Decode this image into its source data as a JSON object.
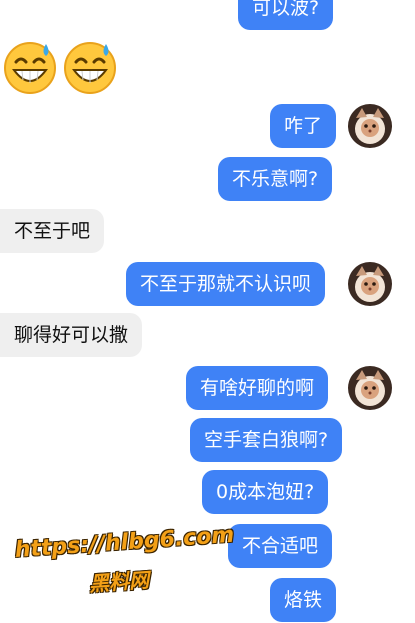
{
  "messages": [
    {
      "side": "me",
      "text": "可以波?"
    },
    {
      "side": "them",
      "emoji": [
        "grinning-sweat-emoji",
        "grinning-sweat-emoji"
      ]
    },
    {
      "side": "me",
      "text": "咋了",
      "avatar": true
    },
    {
      "side": "me",
      "text": "不乐意啊?"
    },
    {
      "side": "them",
      "text": "不至于吧"
    },
    {
      "side": "me",
      "text": "不至于那就不认识呗",
      "avatar": true
    },
    {
      "side": "them",
      "text": "聊得好可以撒"
    },
    {
      "side": "me",
      "text": "有啥好聊的啊",
      "avatar": true
    },
    {
      "side": "me",
      "text": "空手套白狼啊?"
    },
    {
      "side": "me",
      "text": "0成本泡妞?"
    },
    {
      "side": "me",
      "text": "不合适吧"
    },
    {
      "side": "me",
      "text": "烙铁"
    }
  ],
  "watermark": {
    "url": "https://hlbg6.com",
    "name": "黑料网"
  },
  "colors": {
    "me_bubble": "#3f82f6",
    "them_bubble": "#efefef",
    "watermark": "#f3a017"
  }
}
